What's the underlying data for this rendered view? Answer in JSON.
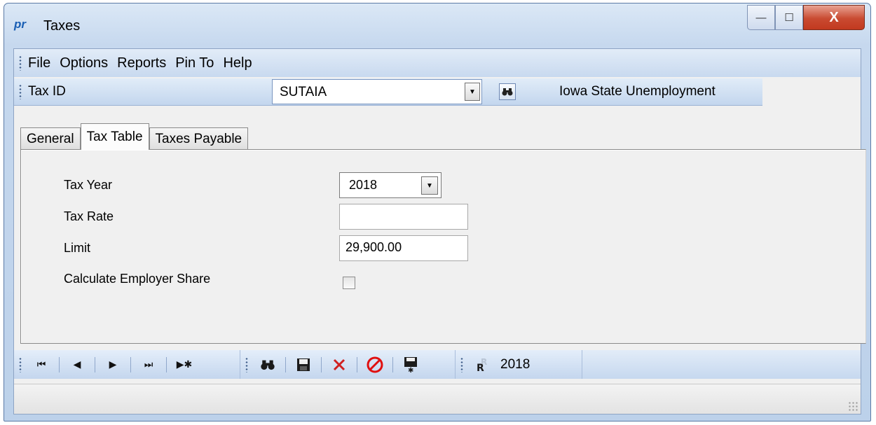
{
  "window": {
    "app_icon": "pr",
    "title": "Taxes",
    "controls": {
      "minimize": "—",
      "maximize": "☐",
      "close": "X"
    }
  },
  "menu": {
    "items": [
      "File",
      "Options",
      "Reports",
      "Pin To",
      "Help"
    ]
  },
  "tax_id_bar": {
    "label": "Tax ID",
    "value": "SUTAIA",
    "description": "Iowa State Unemployment"
  },
  "tabs": [
    {
      "label": "General",
      "active": false
    },
    {
      "label": "Tax Table",
      "active": true
    },
    {
      "label": "Taxes Payable",
      "active": false
    }
  ],
  "form": {
    "tax_year": {
      "label": "Tax Year",
      "value": "2018"
    },
    "tax_rate": {
      "label": "Tax Rate",
      "value": ""
    },
    "limit": {
      "label": "Limit",
      "value": "29,900.00"
    },
    "calculate_employer_share": {
      "label": "Calculate Employer Share",
      "checked": false
    }
  },
  "nav_toolbar": {
    "icons": [
      "first-record-icon",
      "previous-record-icon",
      "next-record-icon",
      "last-record-icon",
      "new-record-icon",
      "find-icon",
      "save-icon",
      "delete-icon",
      "cancel-icon",
      "save-new-icon",
      "report-icon"
    ],
    "year": "2018"
  },
  "colors": {
    "accent": "#c6d8ee",
    "close_button": "#c94a31"
  }
}
